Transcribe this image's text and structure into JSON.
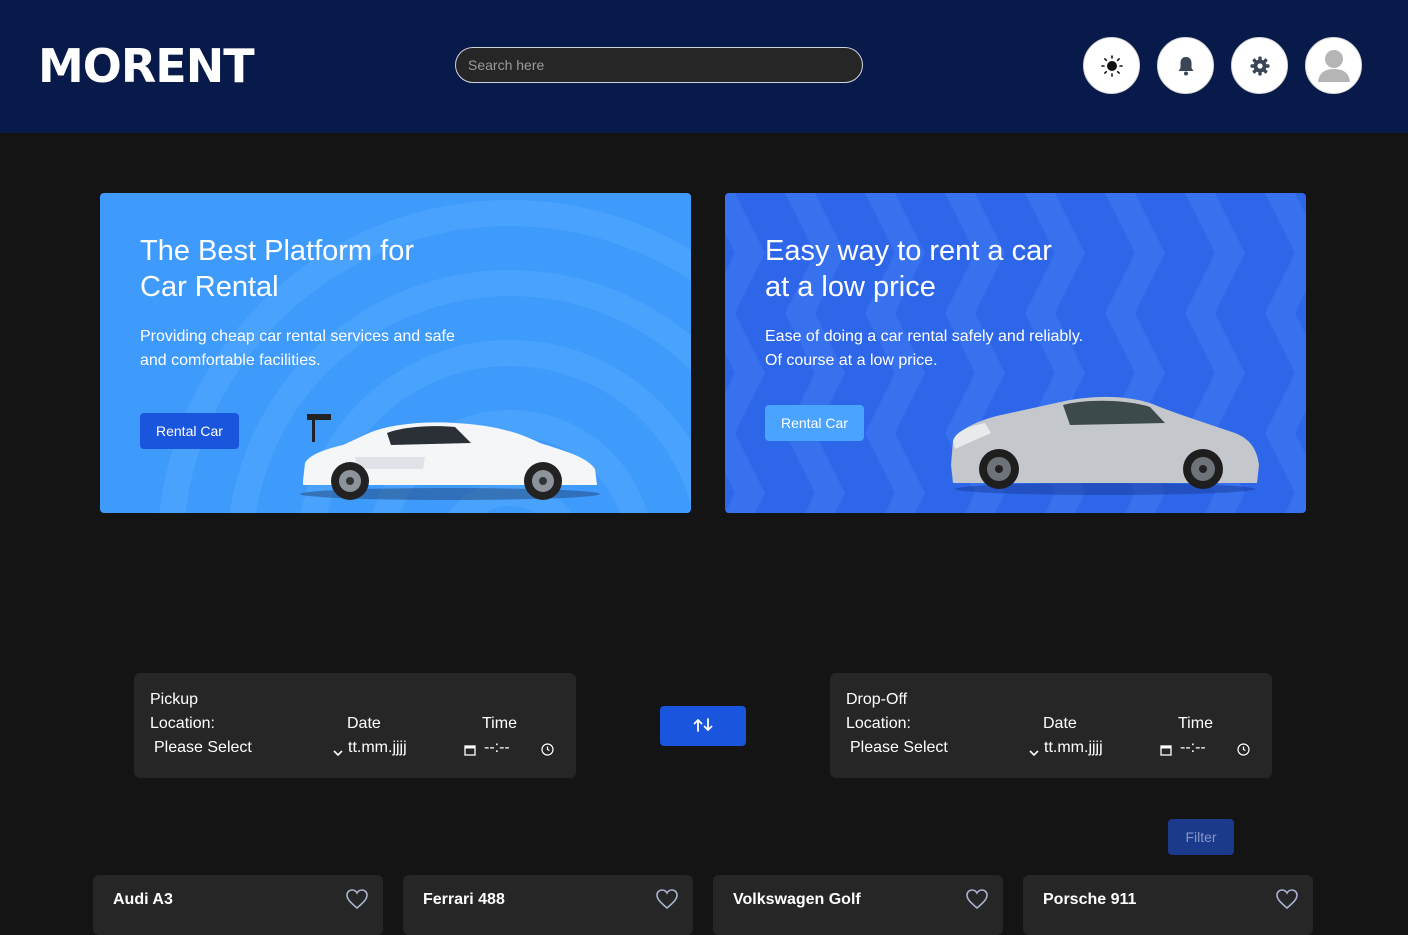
{
  "header": {
    "logo": "MORENT",
    "search_placeholder": "Search here",
    "buttons": [
      "sun-icon",
      "bell-icon",
      "gear-icon",
      "user-avatar-icon"
    ]
  },
  "banners": [
    {
      "title_line1": "The Best Platform for",
      "title_line2": "Car Rental",
      "subtitle_line1": "Providing cheap car rental services and safe",
      "subtitle_line2": "and comfortable facilities.",
      "button": "Rental Car",
      "color": "#3e9bfb"
    },
    {
      "title_line1": "Easy way to rent a car",
      "title_line2": "at a low price",
      "subtitle_line1": "Ease of doing a car rental safely and reliably.",
      "subtitle_line2": "Of course at a low price.",
      "button": "Rental Car",
      "color": "#2d66e8"
    }
  ],
  "pickup": {
    "title": "Pickup",
    "location_label": "Location:",
    "location_value": "Please Select",
    "date_label": "Date",
    "date_value": "tt.mm.jjjj",
    "time_label": "Time",
    "time_value": "--:--"
  },
  "dropoff": {
    "title": "Drop-Off",
    "location_label": "Location:",
    "location_value": "Please Select",
    "date_label": "Date",
    "date_value": "tt.mm.jjjj",
    "time_label": "Time",
    "time_value": "--:--"
  },
  "swap_icon": "swap-vertical-icon",
  "filter_label": "Filter",
  "cars": [
    {
      "name": "Audi A3"
    },
    {
      "name": "Ferrari 488"
    },
    {
      "name": "Volkswagen Golf"
    },
    {
      "name": "Porsche 911"
    }
  ],
  "colors": {
    "header_bg": "#071a4a",
    "page_bg": "#141414",
    "panel_bg": "#262626",
    "primary": "#1a55dd"
  }
}
